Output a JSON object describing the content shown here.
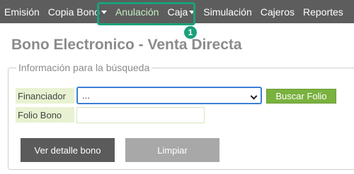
{
  "navbar": {
    "items": [
      {
        "label": "Emisión",
        "has_dropdown": false
      },
      {
        "label": "Copia Bono",
        "has_dropdown": true
      },
      {
        "label": "Anulación",
        "has_dropdown": false,
        "highlighted": true
      },
      {
        "label": "Caja",
        "has_dropdown": true
      },
      {
        "label": "Simulación",
        "has_dropdown": false
      },
      {
        "label": "Cajeros",
        "has_dropdown": false
      },
      {
        "label": "Reportes",
        "has_dropdown": false
      }
    ]
  },
  "annotation": {
    "step": "1",
    "color": "#1aa17b"
  },
  "page": {
    "title": "Bono Electronico - Venta Directa"
  },
  "search_form": {
    "legend": "Información para la búsqueda",
    "financiador_label": "Financiador",
    "financiador_value": "...",
    "buscar_button": "Buscar Folio",
    "folio_label": "Folio Bono",
    "folio_value": ""
  },
  "actions": {
    "detalle_button": "Ver detalle bono",
    "limpiar_button": "Limpiar"
  },
  "colors": {
    "navbar_bg": "#5d5d5d",
    "accent_green": "#7ab13f",
    "label_bg": "#e8f2d2"
  }
}
